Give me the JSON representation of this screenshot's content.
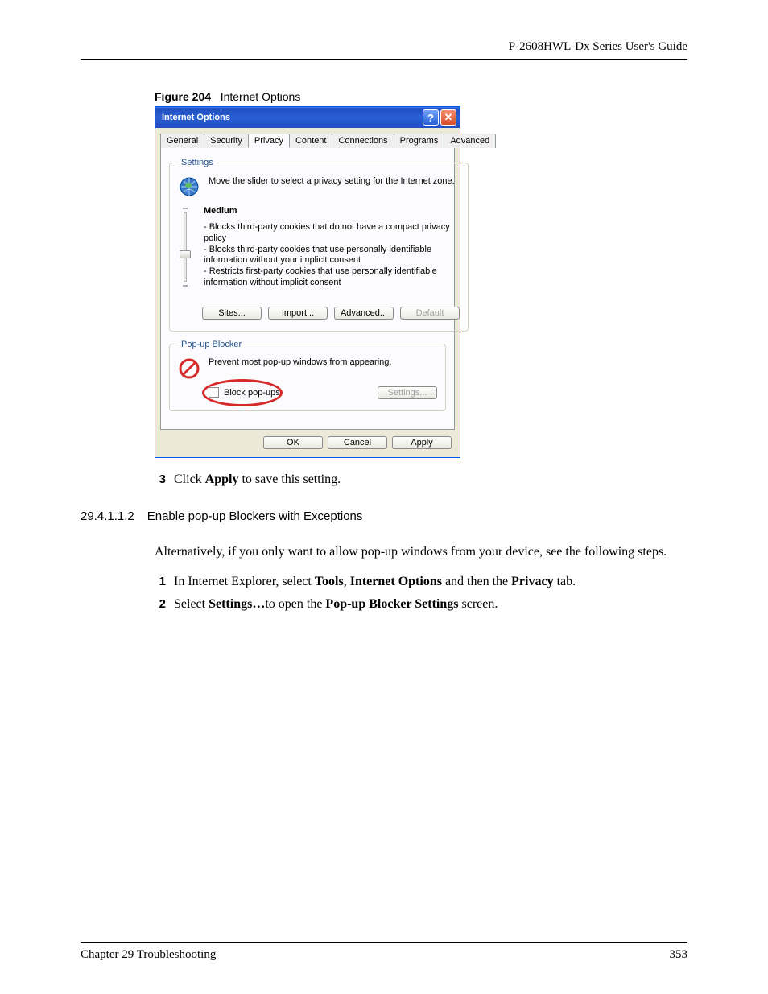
{
  "header": {
    "right": "P-2608HWL-Dx Series User's Guide"
  },
  "figure": {
    "label": "Figure 204",
    "title": "Internet Options"
  },
  "dialog": {
    "title": "Internet Options",
    "tabs": [
      "General",
      "Security",
      "Privacy",
      "Content",
      "Connections",
      "Programs",
      "Advanced"
    ],
    "active_tab": 2,
    "settings": {
      "legend": "Settings",
      "intro": "Move the slider to select a privacy setting for the Internet zone.",
      "level": "Medium",
      "bullets": [
        "- Blocks third-party cookies that do not have a compact privacy policy",
        "- Blocks third-party cookies that use personally identifiable information without your implicit consent",
        "- Restricts first-party cookies that use personally identifiable information without implicit consent"
      ],
      "btn_sites": "Sites...",
      "btn_import": "Import...",
      "btn_advanced": "Advanced...",
      "btn_default": "Default"
    },
    "popup": {
      "legend": "Pop-up Blocker",
      "intro": "Prevent most pop-up windows from appearing.",
      "chk_label": "Block pop-ups",
      "btn_settings": "Settings..."
    },
    "btn_ok": "OK",
    "btn_cancel": "Cancel",
    "btn_apply": "Apply"
  },
  "step3": {
    "num": "3",
    "pre": "Click ",
    "bold": "Apply",
    "post": " to save this setting."
  },
  "section": {
    "num": "29.4.1.1.2",
    "title": "Enable pop-up Blockers with Exceptions"
  },
  "para1": "Alternatively, if you only want to allow pop-up windows from your device, see the following steps.",
  "step1": {
    "num": "1",
    "t1": "In Internet Explorer, select ",
    "b1": "Tools",
    "t2": ", ",
    "b2": "Internet Options",
    "t3": " and then the ",
    "b3": "Privacy",
    "t4": " tab."
  },
  "step2": {
    "num": "2",
    "t1": "Select ",
    "b1": "Settings…",
    "t2": "to open the ",
    "b2": "Pop-up Blocker Settings",
    "t3": " screen."
  },
  "footer": {
    "left": "Chapter 29 Troubleshooting",
    "right": "353"
  }
}
